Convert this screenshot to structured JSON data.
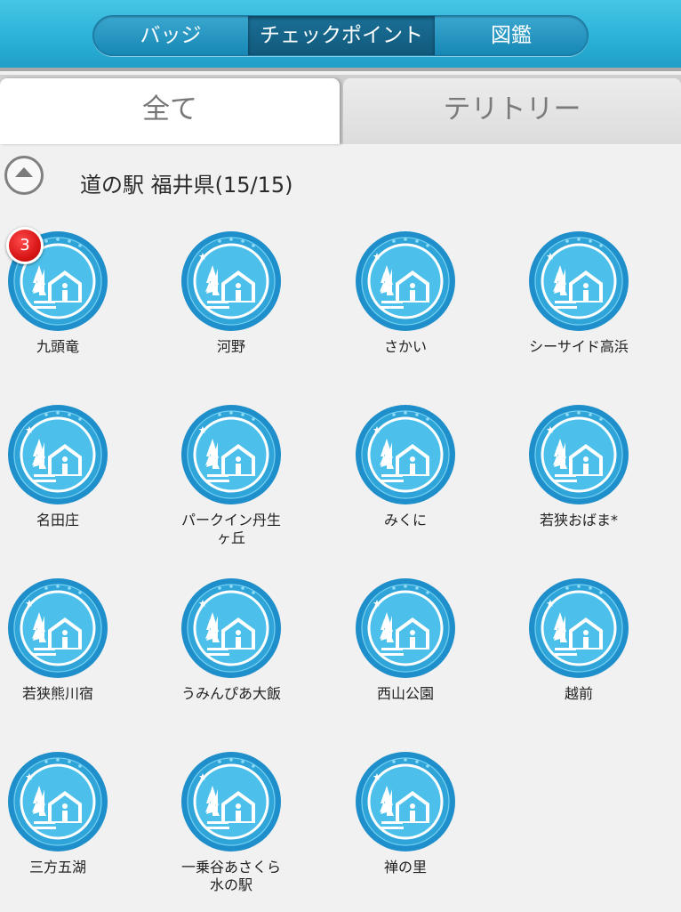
{
  "header": {
    "segments": [
      {
        "label": "バッジ",
        "active": false
      },
      {
        "label": "チェックポイント",
        "active": true
      },
      {
        "label": "図鑑",
        "active": false
      }
    ]
  },
  "tabs": [
    {
      "label": "全て",
      "active": true
    },
    {
      "label": "テリトリー",
      "active": false
    }
  ],
  "section": {
    "title": "道の駅 福井県(15/15)",
    "collapse_icon": "chevron-up-circle-icon"
  },
  "colors": {
    "badge_outer": "#1e8fca",
    "badge_ring": "#2fa4d9",
    "badge_inner": "#4cc0ea",
    "count_badge": "#d81616"
  },
  "badge_icon": "roadside-station-icon",
  "items": [
    {
      "label": "九頭竜",
      "count": "3"
    },
    {
      "label": "河野"
    },
    {
      "label": "さかい"
    },
    {
      "label": "シーサイド高浜"
    },
    {
      "label": "名田庄"
    },
    {
      "label": "パークイン丹生\nヶ丘"
    },
    {
      "label": "みくに"
    },
    {
      "label": "若狭おばま*"
    },
    {
      "label": "若狭熊川宿"
    },
    {
      "label": "うみんぴあ大飯"
    },
    {
      "label": "西山公園"
    },
    {
      "label": "越前"
    },
    {
      "label": "三方五湖"
    },
    {
      "label": "一乗谷あさくら\n水の駅"
    },
    {
      "label": "禅の里"
    }
  ]
}
